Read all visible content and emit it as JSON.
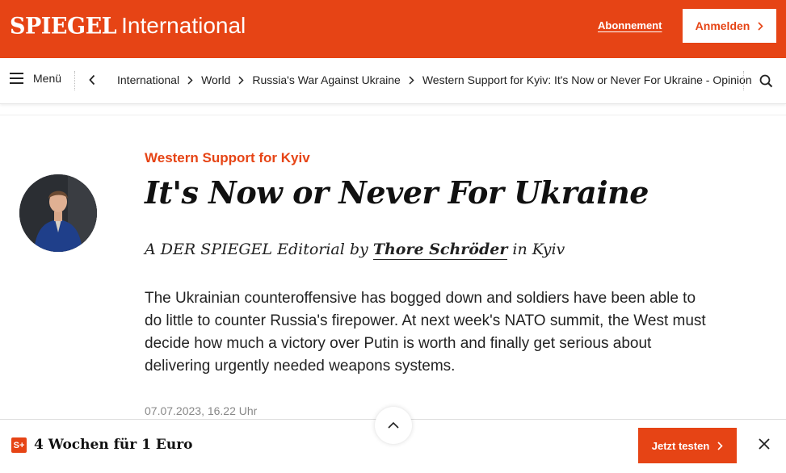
{
  "header": {
    "brand_name": "SPIEGEL",
    "brand_section": "International",
    "subscription_link": "Abonnement",
    "login_button": "Anmelden"
  },
  "nav": {
    "menu_label": "Menü",
    "breadcrumbs": [
      "International",
      "World",
      "Russia's War Against Ukraine",
      "Western Support for Kyiv: It's Now or Never For Ukraine - Opinion"
    ]
  },
  "article": {
    "kicker": "Western Support for Kyiv",
    "headline": "It's Now or Never For Ukraine",
    "byline_prefix": "A DER SPIEGEL Editorial by",
    "author": "Thore Schröder",
    "byline_suffix": "in Kyiv",
    "teaser": "The Ukrainian counteroffensive has bogged down and soldiers have been able to do little to counter Russia's firepower. At next week's NATO summit, the West must decide how much a victory over Putin is worth and finally get serious about delivering urgently needed weapons systems.",
    "date": "07.07.2023, 16.22 Uhr"
  },
  "promo": {
    "badge": "S+",
    "text": "4 Wochen für 1 Euro",
    "cta_button": "Jetzt testen"
  },
  "colors": {
    "brand": "#e64415",
    "text": "#222222",
    "muted": "#888888"
  },
  "icons": {
    "menu": "hamburger-icon",
    "back": "chevron-left-icon",
    "separator": "chevron-right-icon",
    "search": "search-icon",
    "scroll_up": "chevron-up-icon",
    "close": "close-icon"
  }
}
